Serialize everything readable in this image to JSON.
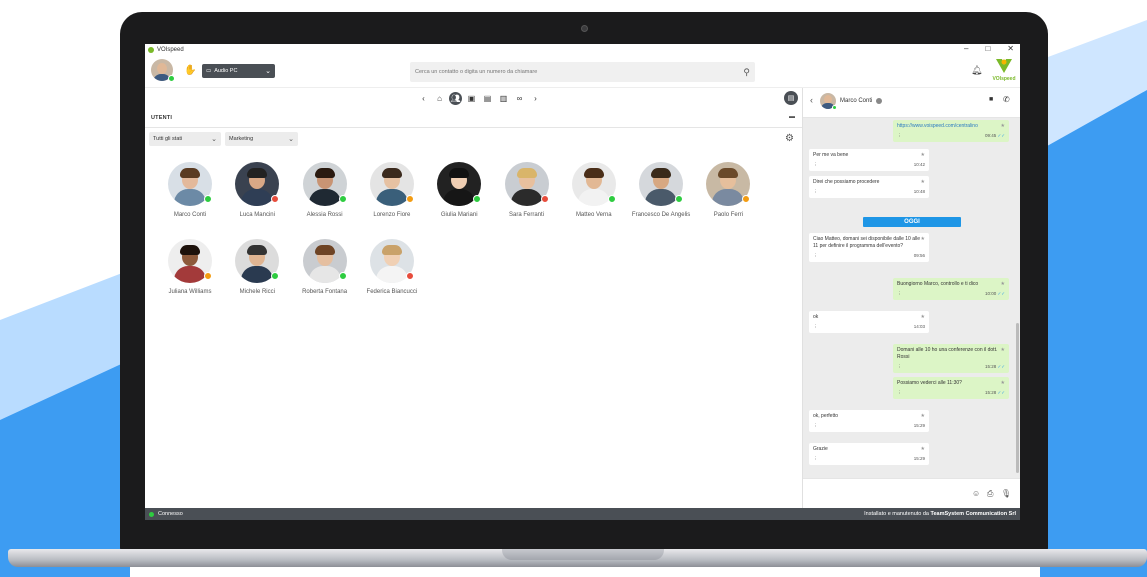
{
  "app": {
    "window_title": "VOIspeed",
    "brand_text": "VOIspeed",
    "window_controls": [
      "–",
      "□",
      "✕"
    ],
    "accent": "#7ab929"
  },
  "header": {
    "audio_label": "Audio PC",
    "search_placeholder": "Cerca un contatto o digita un numero da chiamare"
  },
  "nav": {
    "icons": [
      "chevron-left-icon",
      "home-icon",
      "users-icon",
      "contacts-icon",
      "phonebook-icon",
      "queue-icon",
      "voicemail-icon",
      "chevron-right-icon"
    ]
  },
  "users_section": {
    "title": "UTENTI",
    "status_filter": "Tutti gli stati",
    "group_filter": "Marketing",
    "users": [
      {
        "name": "Marco Conti",
        "status": "available"
      },
      {
        "name": "Luca Mancini",
        "status": "busy"
      },
      {
        "name": "Alessia Rossi",
        "status": "available"
      },
      {
        "name": "Lorenzo Fiore",
        "status": "away"
      },
      {
        "name": "Giulia Mariani",
        "status": "available"
      },
      {
        "name": "Sara Ferranti",
        "status": "busy"
      },
      {
        "name": "Matteo Verna",
        "status": "available"
      },
      {
        "name": "Francesco De Angelis",
        "status": "available"
      },
      {
        "name": "Paolo Ferri",
        "status": "away"
      },
      {
        "name": "Juliana Williams",
        "status": "away"
      },
      {
        "name": "Michele Ricci",
        "status": "available"
      },
      {
        "name": "Roberta Fontana",
        "status": "available"
      },
      {
        "name": "Federica Biancucci",
        "status": "busy"
      }
    ],
    "status_colors": {
      "available": "#2ecc40",
      "busy": "#e74c3c",
      "away": "#f39c12"
    }
  },
  "chat": {
    "contact_name": "Marco Conti",
    "day_badge": "OGGI",
    "messages": [
      {
        "dir": "out",
        "text": "https://www.voispeed.com/centralino",
        "time": "09:45",
        "link": true
      },
      {
        "dir": "in",
        "text": "Per me va bene",
        "time": "10:42"
      },
      {
        "dir": "in",
        "text": "Direi che possiamo procedere",
        "time": "10:48"
      },
      {
        "dir": "in",
        "text": "Ciao Matteo, domani sei disponibile dalle 10 alle 11 per definire il programma dell'evento?",
        "time": "09:56"
      },
      {
        "dir": "out",
        "text": "Buongiorno Marco, controllo e ti dico",
        "time": "10:00"
      },
      {
        "dir": "in",
        "text": "ok",
        "time": "14:03"
      },
      {
        "dir": "out",
        "text": "Domani alle 10 ho una conferenze con il dott. Rossi",
        "time": "15:28"
      },
      {
        "dir": "out",
        "text": "Possiamo vederci alle 11:30?",
        "time": "15:28"
      },
      {
        "dir": "in",
        "text": "ok, perfetto",
        "time": "15:29"
      },
      {
        "dir": "in",
        "text": "Grazie",
        "time": "15:29"
      }
    ]
  },
  "statusbar": {
    "connection": "Connesso",
    "credit_prefix": "Installato e manutenuto da",
    "credit_company": "TeamSystem Communication Srl"
  }
}
